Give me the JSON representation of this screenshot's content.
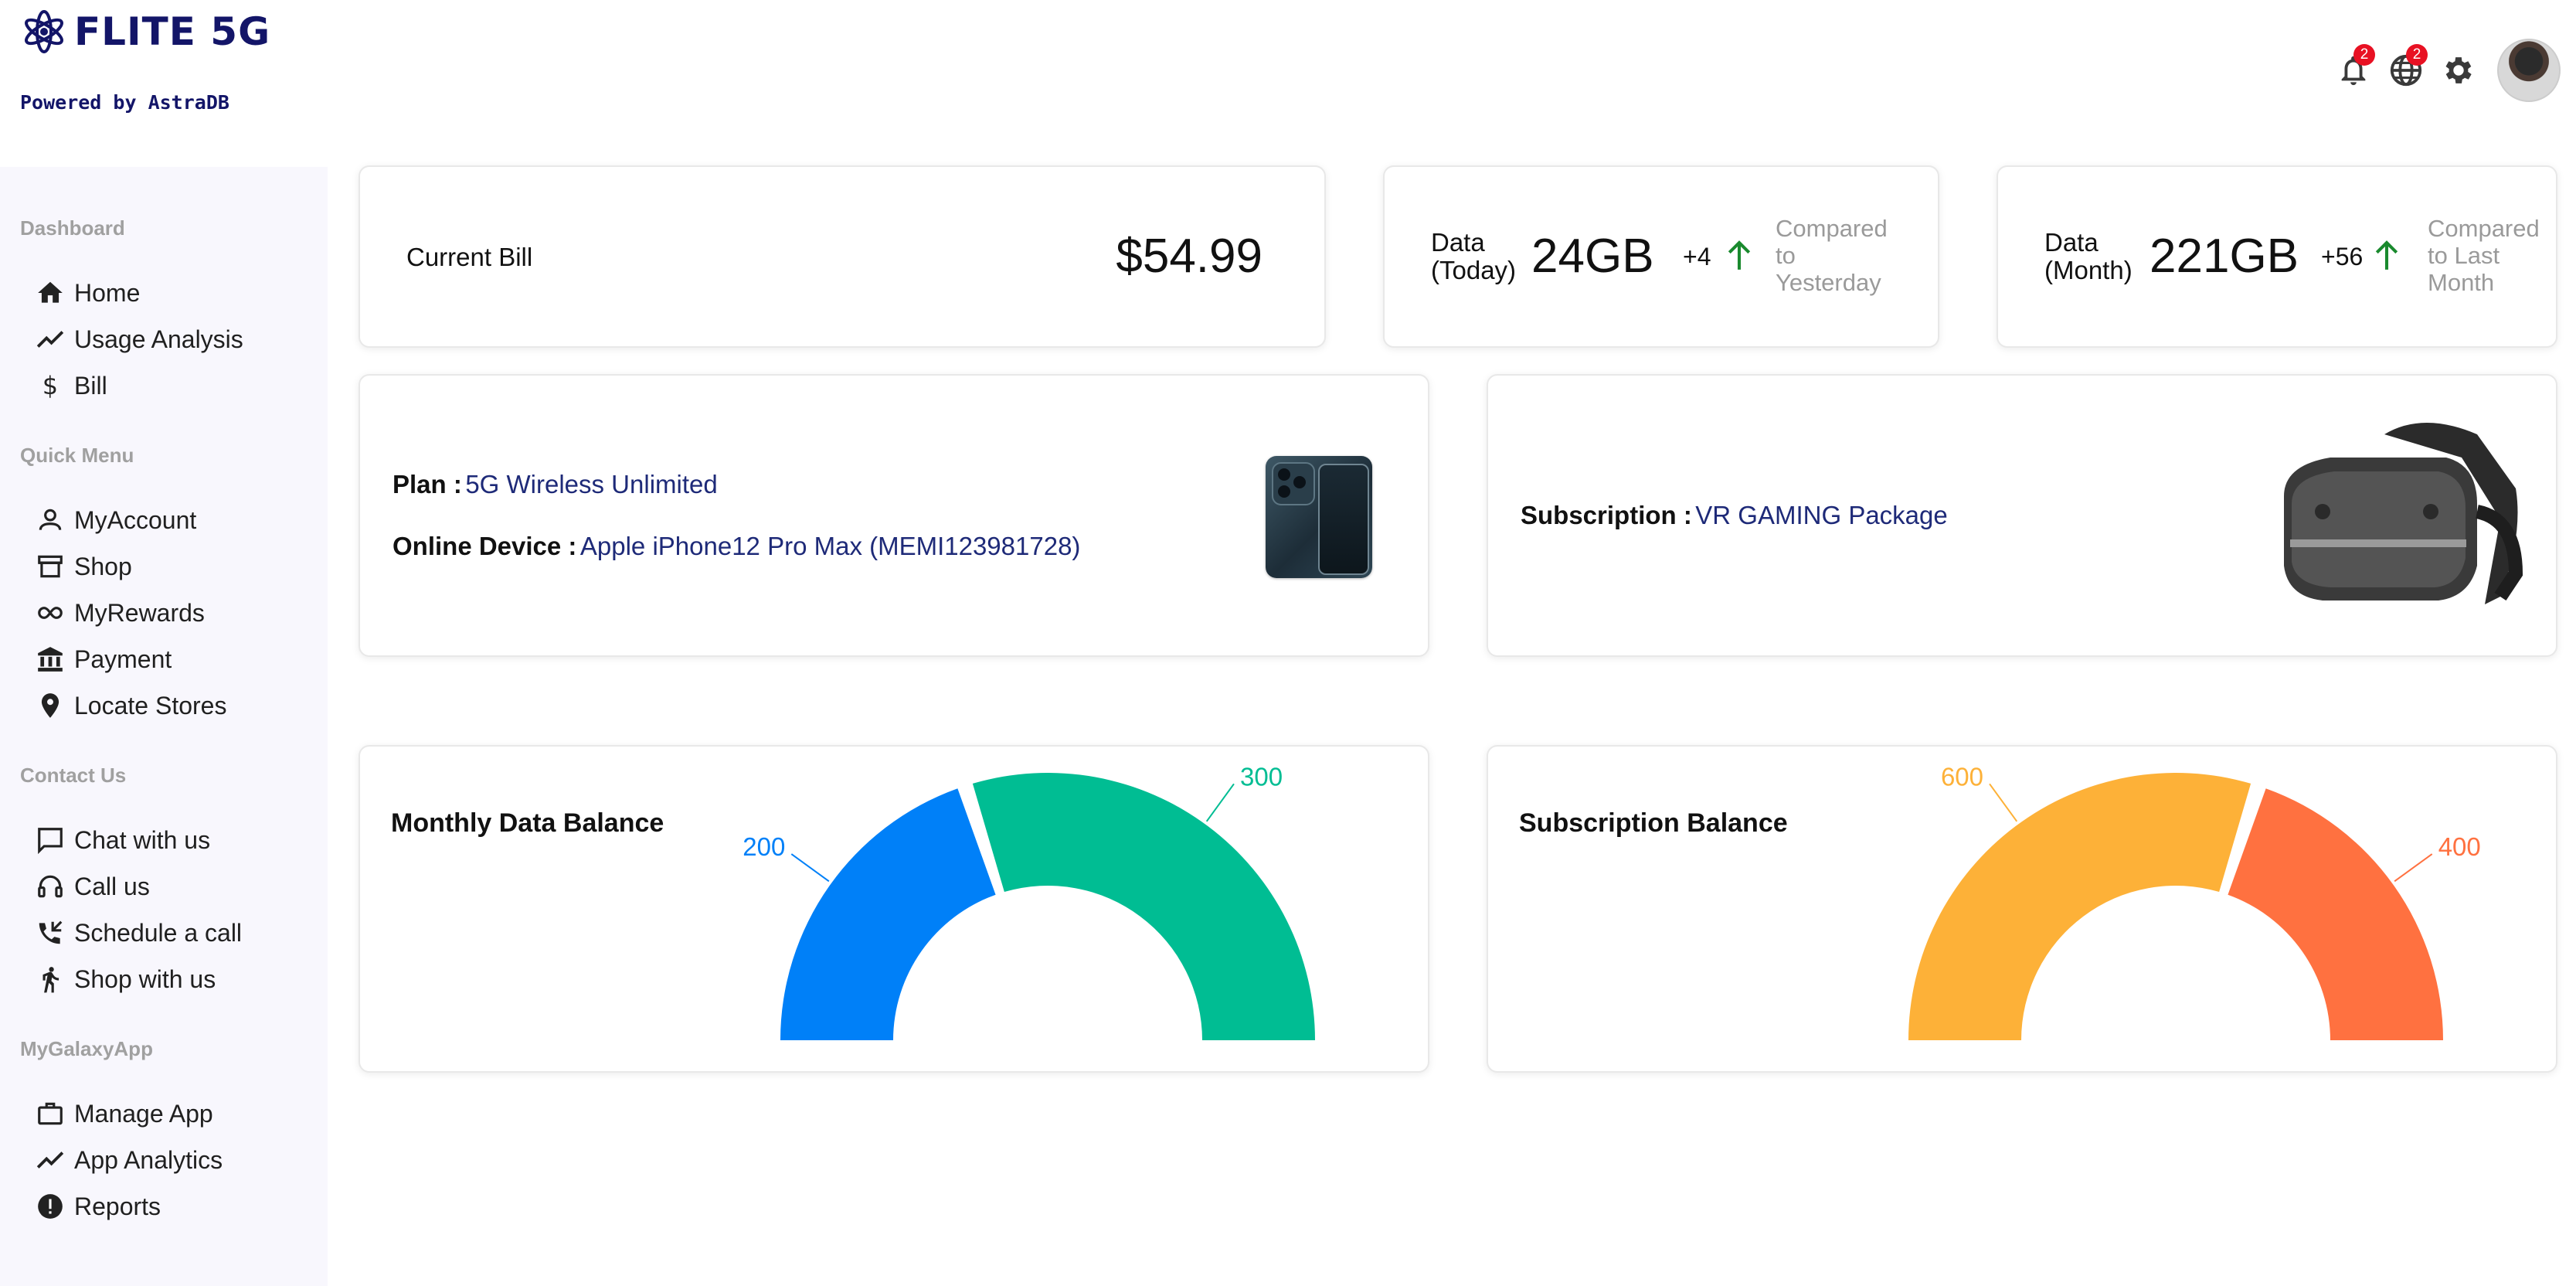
{
  "brand": {
    "name": "FLITE 5G",
    "powered_by": "Powered by AstraDB",
    "color": "#131568"
  },
  "topbar": {
    "notifications_count": "2",
    "language_count": "2"
  },
  "sidebar": {
    "sections": [
      {
        "title": "Dashboard",
        "items": [
          {
            "label": "Home",
            "icon": "home-icon"
          },
          {
            "label": "Usage Analysis",
            "icon": "trending-icon"
          },
          {
            "label": "Bill",
            "icon": "dollar-icon"
          }
        ]
      },
      {
        "title": "Quick Menu",
        "items": [
          {
            "label": "MyAccount",
            "icon": "user-icon"
          },
          {
            "label": "Shop",
            "icon": "store-icon"
          },
          {
            "label": "MyRewards",
            "icon": "infinity-icon"
          },
          {
            "label": "Payment",
            "icon": "bank-icon"
          },
          {
            "label": "Locate Stores",
            "icon": "pin-icon"
          }
        ]
      },
      {
        "title": "Contact Us",
        "items": [
          {
            "label": "Chat with us",
            "icon": "chat-icon"
          },
          {
            "label": "Call us",
            "icon": "headset-icon"
          },
          {
            "label": "Schedule a call",
            "icon": "phone-callback-icon"
          },
          {
            "label": "Shop with us",
            "icon": "walk-icon"
          }
        ]
      },
      {
        "title": "MyGalaxyApp",
        "items": [
          {
            "label": "Manage App",
            "icon": "briefcase-icon"
          },
          {
            "label": "App Analytics",
            "icon": "trending-icon"
          },
          {
            "label": "Reports",
            "icon": "report-icon"
          }
        ]
      }
    ]
  },
  "cards": {
    "bill": {
      "label": "Current Bill",
      "value": "$54.99"
    },
    "data_today": {
      "label_line1": "Data",
      "label_line2": "(Today)",
      "value": "24GB",
      "delta": "+4",
      "compare_line1": "Compared",
      "compare_line2": "to",
      "compare_line3": "Yesterday"
    },
    "data_month": {
      "label_line1": "Data",
      "label_line2": "(Month)",
      "value": "221GB",
      "delta": "+56",
      "compare_line1": "Compared",
      "compare_line2": "to Last",
      "compare_line3": "Month"
    },
    "plan": {
      "plan_key": "Plan :",
      "plan_value": "5G Wireless Unlimited",
      "device_key": "Online Device :",
      "device_value": "Apple iPhone12 Pro Max (MEMI123981728)"
    },
    "subscription": {
      "key": "Subscription :",
      "value": "VR GAMING Package"
    }
  },
  "chart_data": [
    {
      "type": "pie",
      "title": "Monthly Data Balance",
      "variant": "half-donut",
      "categories": [
        "",
        ""
      ],
      "values": [
        200,
        300
      ],
      "colors": [
        "#0080f8",
        "#00bd93"
      ]
    },
    {
      "type": "pie",
      "title": "Subscription Balance",
      "variant": "half-donut",
      "categories": [
        "",
        ""
      ],
      "values": [
        600,
        400
      ],
      "colors": [
        "#fdb138",
        "#ff7140"
      ]
    }
  ]
}
